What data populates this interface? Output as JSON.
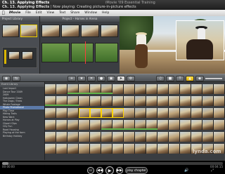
{
  "tutorial": {
    "title": "Ch. 13. Applying Effects",
    "subtitle": "| Now playing: Creating picture-in-picture effects",
    "app_title": "iMovie '09 Essential Training"
  },
  "menubar": {
    "items": [
      "iMovie",
      "File",
      "Edit",
      "View",
      "Text",
      "Share",
      "Window",
      "Help"
    ]
  },
  "panels": {
    "event_browser_header": "Project Library",
    "viewer_header": "Project – Horses in Arena",
    "library_header": "Event Library"
  },
  "library_rows": [
    "Last Import",
    "Dance Tour 2009",
    "2009",
    "Halloween Clean",
    "The Dogs / Trees",
    "Whale Footage",
    "Photo Promotional",
    "Play Time",
    "Hiking Trails",
    "New Work",
    "Horses at Play",
    "Clipart Clips",
    "City Fun",
    "Road Housing",
    "Playing at the farm",
    "Birthday Holiday"
  ],
  "selected_library_row": 6,
  "watermark": "lynda.com",
  "player": {
    "time_current": "00:00:00",
    "time_total": "00:04:15",
    "progress": 0.03,
    "play_chapter_label": "play chapter",
    "cc_label": "CC"
  },
  "icons": {
    "apple": "apple-icon",
    "rewind": "rewind-icon",
    "play": "play-icon",
    "forward": "forward-icon",
    "volume": "volume-icon",
    "fullscreen": "fullscreen-icon"
  }
}
